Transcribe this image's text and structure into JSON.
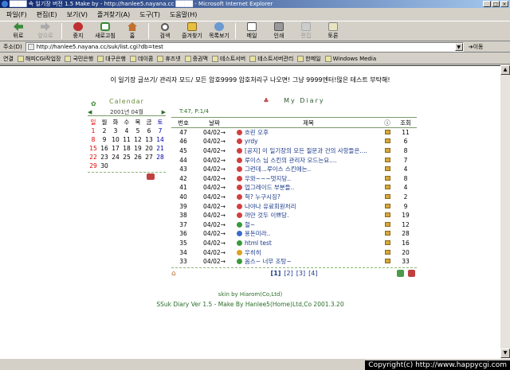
{
  "window": {
    "title": "████ 속 일기장 버전 1.5 Make by - http://hanlee5.nayana.cc ████ - Microsoft Internet Explorer"
  },
  "menu": [
    "파일(F)",
    "편집(E)",
    "보기(V)",
    "즐겨찾기(A)",
    "도구(T)",
    "도움말(H)"
  ],
  "toolbar": {
    "back": "뒤로",
    "forward": "앞으로",
    "stop": "중지",
    "refresh": "새로고침",
    "home": "홈",
    "search": "검색",
    "favorites": "즐겨찾기",
    "history": "목록보기",
    "mail": "메일",
    "print": "인쇄",
    "edit": "편집",
    "discuss": "토론"
  },
  "address": {
    "label": "주소(D)",
    "url": "http://hanlee5.nayana.cc/suk/list.cgi?db=test",
    "go": "이동"
  },
  "links": {
    "label": "연결",
    "items": [
      "해피CGI작업장",
      "국민은행",
      "대구은행",
      "데이콤",
      "휴즈넷",
      "증권맥",
      "테스트서버",
      "테스트서버관리",
      "한메일",
      "Windows Media"
    ]
  },
  "page": {
    "notice": "이 일기장 글쓰기/ 관리자 모드/ 모든 암호9999 암호처리구 나오면! 그냥 9999엔터!많은 테스트 부탁해!",
    "calendar": {
      "title": "Calendar",
      "prev": "◀",
      "next": "▶",
      "year_month": "2001년 04월",
      "weekdays": [
        "일",
        "월",
        "화",
        "수",
        "목",
        "금",
        "토"
      ],
      "weeks": [
        [
          "1",
          "2",
          "3",
          "4",
          "5",
          "6",
          "7"
        ],
        [
          "8",
          "9",
          "10",
          "11",
          "12",
          "13",
          "14"
        ],
        [
          "15",
          "16",
          "17",
          "18",
          "19",
          "20",
          "21"
        ],
        [
          "22",
          "23",
          "24",
          "25",
          "26",
          "27",
          "28"
        ],
        [
          "29",
          "30",
          "",
          "",
          "",
          "",
          ""
        ]
      ]
    },
    "diary": {
      "title": "My Diary",
      "stats": "T:47, P:1/4",
      "headers": {
        "no": "번호",
        "date": "날짜",
        "subject": "제목",
        "info": "ⓘ",
        "views": "조회"
      },
      "rows": [
        {
          "no": "47",
          "date": "04/02→",
          "subject": "흐린 오후",
          "dot": "#d04040",
          "views": "11"
        },
        {
          "no": "46",
          "date": "04/02→",
          "subject": "yrdy",
          "dot": "#d04040",
          "views": "6"
        },
        {
          "no": "45",
          "date": "04/02→",
          "subject": "[공지] 이 일기장의 모든 질문과 건의 사항들은....",
          "dot": "#d04040",
          "views": "8"
        },
        {
          "no": "44",
          "date": "04/02→",
          "subject": "루이스 님 스킨의 관리자 모드는요....",
          "dot": "#d04040",
          "views": "7"
        },
        {
          "no": "43",
          "date": "04/02→",
          "subject": "그런데...루이스 스킨에는..",
          "dot": "#d04040",
          "views": "4"
        },
        {
          "no": "42",
          "date": "04/02→",
          "subject": "우와~~~멋지당..",
          "dot": "#d04040",
          "views": "8"
        },
        {
          "no": "41",
          "date": "04/02→",
          "subject": "업그레이드 부분들..",
          "dot": "#d04040",
          "views": "4"
        },
        {
          "no": "40",
          "date": "04/02→",
          "subject": "헉? 누구시징?",
          "dot": "#d04040",
          "views": "2"
        },
        {
          "no": "39",
          "date": "04/02→",
          "subject": "나야나 유료회원처리",
          "dot": "#d04040",
          "views": "9"
        },
        {
          "no": "38",
          "date": "04/02→",
          "subject": "까만 것두 이쁘당.",
          "dot": "#d04040",
          "views": "19"
        },
        {
          "no": "37",
          "date": "04/02→",
          "subject": "헐~",
          "dot": "#3a9a3a",
          "views": "12"
        },
        {
          "no": "36",
          "date": "04/02→",
          "subject": "용돈미라..",
          "dot": "#3a6ad0",
          "views": "28"
        },
        {
          "no": "35",
          "date": "04/02→",
          "subject": "html test",
          "dot": "#3a9a3a",
          "views": "16"
        },
        {
          "no": "34",
          "date": "04/02→",
          "subject": "우히히",
          "dot": "#e0a020",
          "views": "20"
        },
        {
          "no": "33",
          "date": "04/02→",
          "subject": "옴스~ 너무 조탕~",
          "dot": "#3a9a3a",
          "views": "33"
        }
      ],
      "pages": {
        "current": "[1]",
        "others": [
          "[2]",
          "[3]",
          "[4]"
        ]
      },
      "skin": "skin by Hiarom(Co,Ltd)",
      "credit": "SSuk Diary Ver 1.5 - Make By Hanlee5(Home)Ltd,Co 2001.3.20"
    }
  },
  "status": {
    "copyright": "Copyright(c) http://www.happycgi.com"
  }
}
